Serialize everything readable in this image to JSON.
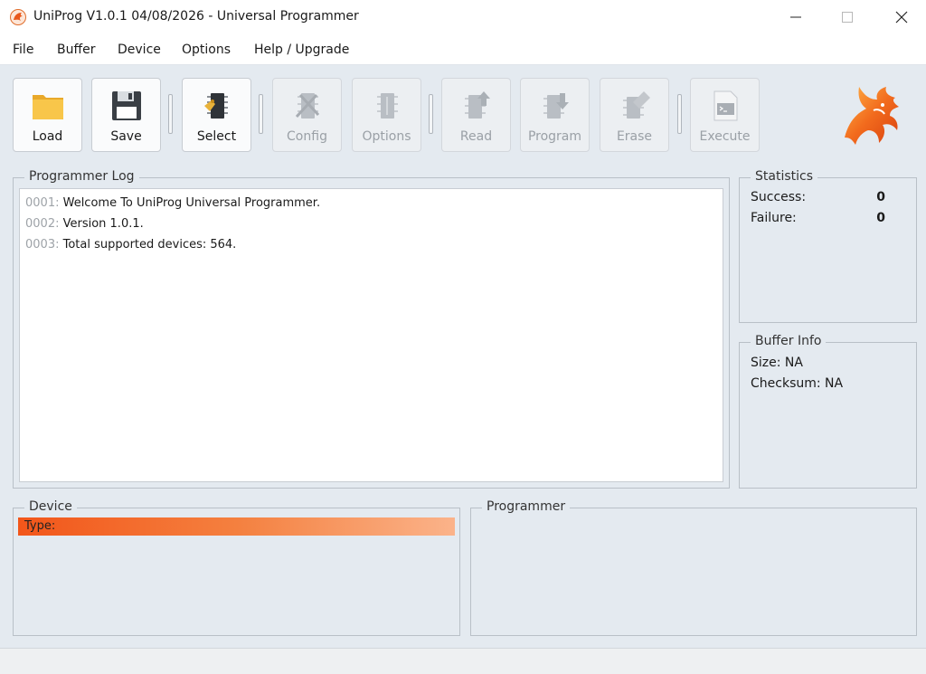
{
  "window": {
    "title": "UniProg V1.0.1 04/08/2026 - Universal Programmer",
    "minimize_glyph": "—",
    "maximize_glyph": "☐",
    "close_glyph": "✕"
  },
  "menu": [
    "File",
    "Buffer",
    "Device",
    "Options",
    "Help / Upgrade"
  ],
  "toolbar": {
    "load": "Load",
    "save": "Save",
    "select": "Select",
    "config": "Config",
    "options": "Options",
    "read": "Read",
    "program": "Program",
    "erase": "Erase",
    "execute": "Execute"
  },
  "log": {
    "title": "Programmer Log",
    "lines": [
      {
        "num": "0001:",
        "text": " Welcome To UniProg Universal Programmer."
      },
      {
        "num": "0002:",
        "text": " Version 1.0.1."
      },
      {
        "num": "0003:",
        "text": " Total supported devices: 564."
      }
    ]
  },
  "statistics": {
    "title": "Statistics",
    "success_label": "Success:",
    "success_value": "0",
    "failure_label": "Failure:",
    "failure_value": "0"
  },
  "buffer_info": {
    "title": "Buffer Info",
    "size": "Size: NA",
    "checksum": "Checksum: NA"
  },
  "device": {
    "title": "Device",
    "type_label": "Type:"
  },
  "programmer": {
    "title": "Programmer"
  },
  "colors": {
    "accent_orange": "#f2561a",
    "background": "#e4eaf0",
    "disabled_text": "#9aa0a6"
  },
  "icons": {
    "app": "dragon-icon",
    "load": "folder-icon",
    "save": "floppy-disk-icon",
    "select": "chip-select-icon",
    "config": "chip-tools-icon",
    "options": "chip-options-icon",
    "read": "chip-read-icon",
    "program": "chip-program-icon",
    "erase": "chip-erase-icon",
    "execute": "terminal-icon",
    "logo": "dragon-logo-icon"
  }
}
